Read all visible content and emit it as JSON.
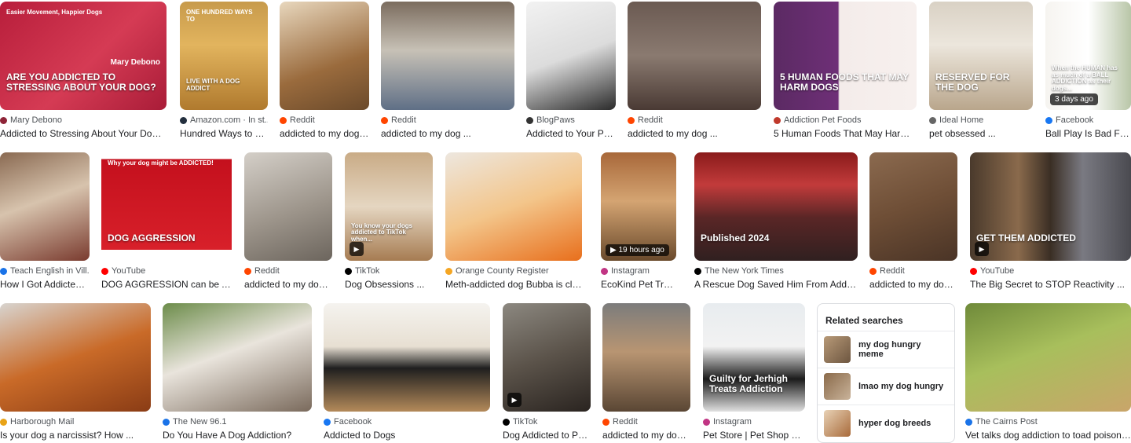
{
  "results": [
    {
      "source": "Mary Debono",
      "title": "Addicted to Stressing About Your Dog ...",
      "icon_color": "#8e2438",
      "bg": "linear-gradient(135deg,#b81e3b,#d53b54 55%,#a91c38)",
      "overlay": "ARE YOU ADDICTED TO STRESSING ABOUT YOUR DOG?",
      "overlay2": "Easier Movement, Happier Dogs",
      "overlay3": "Mary Debono"
    },
    {
      "source": "Amazon.com · In st...",
      "title": "Hundred Ways to Li...",
      "icon_color": "#232f3e",
      "bg": "linear-gradient(180deg,#c79a4b,#e2b45e 40%,#b07a2e)",
      "overlay": "LIVE WITH A DOG ADDICT",
      "overlay2": "ONE HUNDRED WAYS TO"
    },
    {
      "source": "Reddit",
      "title": "addicted to my dog ...",
      "icon_color": "#ff4500",
      "bg": "linear-gradient(160deg,#e8d7bd,#9a6b3d 60%,#6b4a2b)"
    },
    {
      "source": "Reddit",
      "title": "addicted to my dog ...",
      "icon_color": "#ff4500",
      "bg": "linear-gradient(180deg,#7b6c5e,#c7c1b6 45%,#5f6f86)"
    },
    {
      "source": "BlogPaws",
      "title": "Addicted to Your Pe...",
      "icon_color": "#333333",
      "bg": "linear-gradient(160deg,#f2f2f2,#dcdcdc 50%,#2b2b2b)"
    },
    {
      "source": "Reddit",
      "title": "addicted to my dog ...",
      "icon_color": "#ff4500",
      "bg": "linear-gradient(180deg,#6b5a52,#8a7a70 50%,#4a3a34)"
    },
    {
      "source": "Addiction Pet Foods",
      "title": "5 Human Foods That May Harm D...",
      "icon_color": "#c0392b",
      "bg": "linear-gradient(90deg,#5b2a63,#6e2f77 45%,#f4ecea 46%,#f7f0ee)",
      "overlay": "5 HUMAN FOODS THAT MAY HARM DOGS"
    },
    {
      "source": "Ideal Home",
      "title": "pet obsessed ...",
      "icon_color": "#666666",
      "bg": "linear-gradient(180deg,#d9d1c4,#ece6dc 40%,#b9a68c)",
      "overlay": "RESERVED FOR THE DOG"
    },
    {
      "source": "Facebook",
      "title": "Ball Play Is Bad For ...",
      "icon_color": "#1877f2",
      "bg": "linear-gradient(90deg,#f6f4f0,#ffffff 50%,#b9c6a8)",
      "badge": "3 days ago",
      "overlay": "When the HUMAN has as much of a BALL ADDICTION as their dogs..."
    },
    {
      "source": "Teach English in Vill...",
      "title": "How I Got Addicted ...",
      "icon_color": "#1a73e8",
      "bg": "linear-gradient(160deg,#8a6a52,#d7c3ad 45%,#7a3b2f)"
    },
    {
      "source": "YouTube",
      "title": "DOG AGGRESSION can be AD...",
      "icon_color": "#ff0000",
      "bg": "linear-gradient(180deg,#ffffff 0,#ffffff 6%,#c4101d 6%,#d8202a 90%,#ffffff 90%)",
      "overlay": "DOG AGGRESSION",
      "overlay2": "Why your dog might be ADDICTED!"
    },
    {
      "source": "Reddit",
      "title": "addicted to my dog ...",
      "icon_color": "#ff4500",
      "bg": "linear-gradient(160deg,#d4cfc8,#9d958b 55%,#6c655d)"
    },
    {
      "source": "TikTok",
      "title": "Dog Obsessions ...",
      "icon_color": "#000000",
      "bg": "linear-gradient(180deg,#c9ab86,#e5d6c1 50%,#a67c52)",
      "play": true,
      "overlay": "You know your dogs addicted to TikTok when..."
    },
    {
      "source": "Orange County Register",
      "title": "Meth-addicted dog Bubba is cle...",
      "icon_color": "#f5a623",
      "bg": "linear-gradient(160deg,#ede7df,#f3c58a 50%,#e86f1c)"
    },
    {
      "source": "Instagram",
      "title": "EcoKind Pet Treats ...",
      "icon_color": "#c13584",
      "bg": "linear-gradient(180deg,#a8683a,#d4a472 45%,#6a4a2c)",
      "badge": "▶ 19 hours ago"
    },
    {
      "source": "The New York Times",
      "title": "A Rescue Dog Saved Him From Addicti...",
      "icon_color": "#000000",
      "bg": "linear-gradient(180deg,#8a1b1b,#c23b3b 30%,#5a2626 60%,#302020)",
      "overlay": "Published 2024"
    },
    {
      "source": "Reddit",
      "title": "addicted to my dog ...",
      "icon_color": "#ff4500",
      "bg": "linear-gradient(160deg,#8b6a4f,#6e4e36 50%,#4a3426)"
    },
    {
      "source": "YouTube",
      "title": "The Big Secret to STOP Reactivity ...",
      "icon_color": "#ff0000",
      "bg": "linear-gradient(90deg,#4a3a2c,#8a6a4c 30%,#3a2e24 50%,#7a7a82 70%,#4a4a50)",
      "play": true,
      "overlay": "GET THEM ADDICTED"
    },
    {
      "source": "Harborough Mail",
      "title": "Is your dog a narcissist? How ...",
      "icon_color": "#e8a317",
      "bg": "linear-gradient(160deg,#d8d4cf,#c96a28 50%,#8a3c15)"
    },
    {
      "source": "The New 96.1",
      "title": "Do You Have A Dog Addiction?",
      "icon_color": "#1a73e8",
      "bg": "linear-gradient(160deg,#6c8c4a,#e9e4dc 45%,#7a6a5c)"
    },
    {
      "source": "Facebook",
      "title": "Addicted to Dogs",
      "icon_color": "#1877f2",
      "bg": "linear-gradient(180deg,#f5f3ef,#e7dfd2 40%,#1f1f1f 60%,#b48a5a)"
    },
    {
      "source": "TikTok",
      "title": "Dog Addicted to Pu...",
      "icon_color": "#000000",
      "bg": "linear-gradient(160deg,#8c8880,#5b534a 50%,#2a2420)",
      "play": true
    },
    {
      "source": "Reddit",
      "title": "addicted to my dog ...",
      "icon_color": "#ff4500",
      "bg": "linear-gradient(180deg,#7c7c7c,#b89572 45%,#5a4634)"
    },
    {
      "source": "Instagram",
      "title": "Pet Store | Pet Shop Go...",
      "icon_color": "#c13584",
      "bg": "linear-gradient(180deg,#e8ecef,#f2f2f2 40%,#1b1b1b 70%,#e0e0e0)",
      "overlay": "Guilty for Jerhigh Treats Addiction"
    },
    {
      "source": "The Cairns Post",
      "title": "Vet talks dog addiction to toad poison ...",
      "icon_color": "#1a73e8",
      "bg": "linear-gradient(160deg,#6f8a3a,#a8bf5c 45%,#c9a56a)"
    }
  ],
  "related": {
    "heading": "Related searches",
    "items": [
      {
        "text": "my dog hungry meme",
        "bold_prefix": "my ",
        "bold_main": "dog hungry meme",
        "thumb": "linear-gradient(135deg,#b89a78,#6d5640)"
      },
      {
        "text": "lmao my dog hungry",
        "bold_prefix": "lmao ",
        "bold_main": "my dog hungry",
        "thumb": "linear-gradient(135deg,#8a6a4a,#c9b39a)"
      },
      {
        "text": "hyper dog breeds",
        "bold_prefix": "hyper ",
        "bold_main": "dog breeds",
        "thumb": "linear-gradient(135deg,#e8d2b6,#a86a3a)"
      }
    ]
  }
}
